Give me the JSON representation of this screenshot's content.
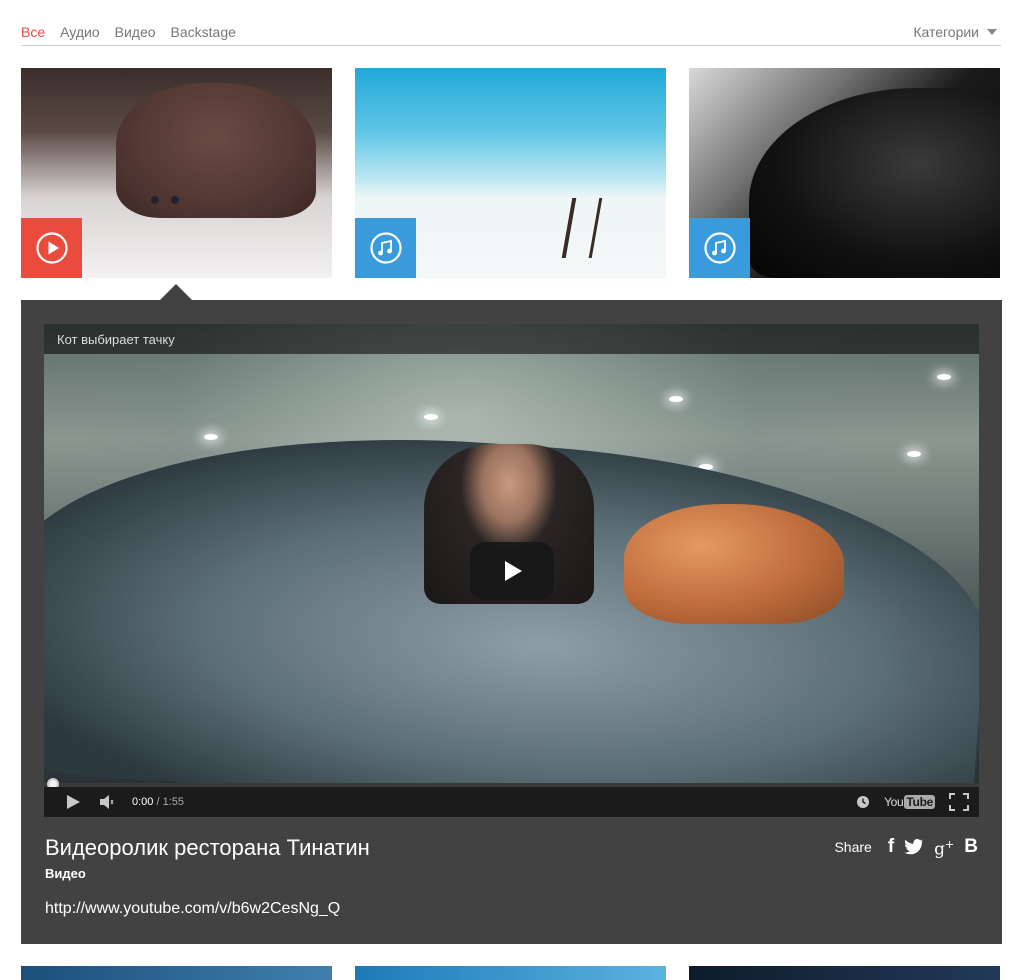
{
  "filters": {
    "tabs": [
      "Все",
      "Аудио",
      "Видео",
      "Backstage"
    ],
    "active_tab": "Все",
    "category_label": "Категории"
  },
  "tiles": [
    {
      "type": "video",
      "badge_color": "#e94c3d",
      "icon": "play-circle-icon"
    },
    {
      "type": "audio",
      "badge_color": "#3a9bdc",
      "icon": "music-note-icon"
    },
    {
      "type": "audio",
      "badge_color": "#3a9bdc",
      "icon": "music-note-icon"
    }
  ],
  "player": {
    "video_title": "Кот выбирает тачку",
    "time_current": "0:00",
    "time_separator": "/",
    "time_total": "1:55",
    "progress": 0.0,
    "logo_text": "You",
    "logo_tube": "Tube"
  },
  "details": {
    "name": "Видеоролик ресторана Тинатин",
    "category": "Видео",
    "link": "http://www.youtube.com/v/b6w2CesNg_Q",
    "share_label": "Share",
    "share_icons": [
      "f",
      "twitter-bird",
      "g+",
      "B"
    ]
  },
  "colors": {
    "accent_red": "#e94c3d",
    "accent_blue": "#3a9bdc",
    "panel_bg": "#424242"
  }
}
